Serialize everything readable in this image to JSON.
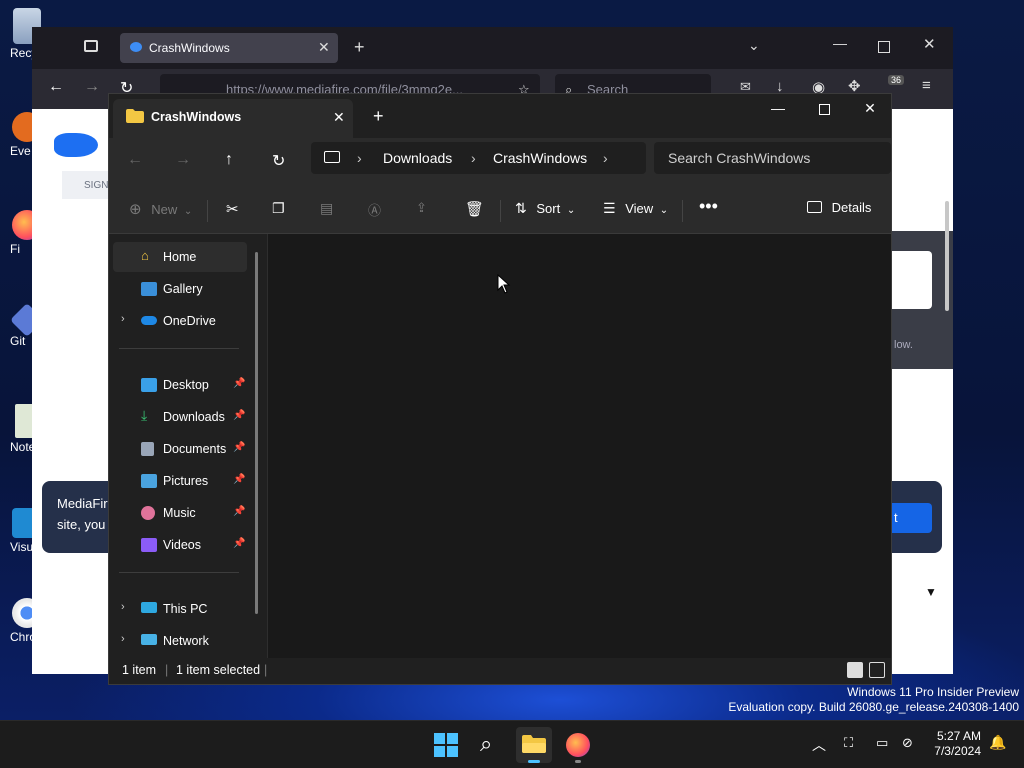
{
  "desktop": {
    "icons": [
      {
        "label": "Recy"
      },
      {
        "label": "Eve"
      },
      {
        "label": "Fi"
      },
      {
        "label": "Git"
      },
      {
        "label": "Note"
      },
      {
        "label": "Visua"
      },
      {
        "label": "Chro"
      }
    ]
  },
  "browser": {
    "tab_title": "CrashWindows",
    "url": "https://www.mediafire.com/file/3mmq2e...",
    "search_placeholder": "Search",
    "badge": "36",
    "page": {
      "sign_label": "SIGN",
      "toast_line1": "MediaFir",
      "toast_line2": "site, you",
      "btn_fragment": "t",
      "follow_fragment": "low."
    }
  },
  "explorer": {
    "tab_title": "CrashWindows",
    "breadcrumb": [
      "Downloads",
      "CrashWindows"
    ],
    "search_placeholder": "Search CrashWindows",
    "commands": {
      "new": "New",
      "sort": "Sort",
      "view": "View",
      "details": "Details"
    },
    "nav": {
      "home": "Home",
      "gallery": "Gallery",
      "onedrive": "OneDrive",
      "desktop": "Desktop",
      "downloads": "Downloads",
      "documents": "Documents",
      "pictures": "Pictures",
      "music": "Music",
      "videos": "Videos",
      "this_pc": "This PC",
      "network": "Network"
    },
    "status": {
      "items": "1 item",
      "selected": "1 item selected"
    }
  },
  "watermark": {
    "line1": "Windows 11 Pro Insider Preview",
    "line2": "Evaluation copy. Build 26080.ge_release.240308-1400"
  },
  "taskbar": {
    "time": "5:27 AM",
    "date": "7/3/2024"
  },
  "colors": {
    "accent": "#4cc2ff",
    "explorer_bg": "#191919",
    "folder": "#f3c743"
  }
}
